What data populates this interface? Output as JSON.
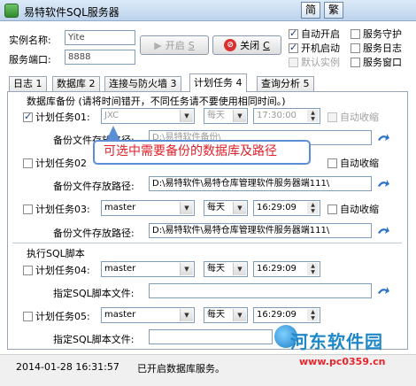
{
  "window": {
    "title": "易特软件SQL服务器",
    "btn_simplified": "简",
    "btn_traditional": "繁"
  },
  "top": {
    "instance_label": "实例名称:",
    "instance_value": "Yite",
    "port_label": "服务端口:",
    "port_value": "8888",
    "start_label": "开启",
    "start_key": "S",
    "close_label": "关闭",
    "close_key": "C",
    "checks": [
      {
        "label": "自动开启",
        "checked": true
      },
      {
        "label": "服务守护",
        "checked": false
      },
      {
        "label": "开机启动",
        "checked": true
      },
      {
        "label": "服务日志",
        "checked": false
      },
      {
        "label": "默认实例",
        "checked": false,
        "disabled": true
      },
      {
        "label": "服务窗口",
        "checked": false
      }
    ]
  },
  "tabs": [
    {
      "label": "日志 1"
    },
    {
      "label": "数据库 2"
    },
    {
      "label": "连接与防火墙 3"
    },
    {
      "label": "计划任务 4",
      "active": true
    },
    {
      "label": "查询分析 5"
    }
  ],
  "backup": {
    "section_title": "数据库备份 (请将时间错开，不同任务请不要使用相同时间。)",
    "path_label": "备份文件存放路径:",
    "tasks": [
      {
        "label": "计划任务01:",
        "checked": true,
        "db": "JXC",
        "freq": "每天",
        "time": "17:30:00",
        "auto_compress": "自动收缩",
        "path": "D:\\易特软件备份\\",
        "disabled": true
      },
      {
        "label": "计划任务02",
        "checked": false,
        "db": "",
        "freq": "",
        "time": "",
        "auto_compress": "自动收缩",
        "path": "D:\\易特软件\\易特仓库管理软件服务器端111\\"
      },
      {
        "label": "计划任务03:",
        "checked": false,
        "db": "master",
        "freq": "每天",
        "time": "16:29:09",
        "auto_compress": "自动收缩",
        "path": "D:\\易特软件\\易特仓库管理软件服务器端111\\"
      }
    ]
  },
  "sql": {
    "section_title": "执行SQL脚本",
    "file_label": "指定SQL脚本文件:",
    "tasks": [
      {
        "label": "计划任务04:",
        "db": "master",
        "freq": "每天",
        "time": "16:29:09",
        "file": ""
      },
      {
        "label": "计划任务05:",
        "db": "master",
        "freq": "每天",
        "time": "16:29:09",
        "file": ""
      }
    ]
  },
  "tooltip": "可选中需要备份的数据库及路径",
  "status": {
    "datetime": "2014-01-28 16:31:57",
    "message": "已开启数据库服务。"
  },
  "watermark": {
    "text": "河东软件园",
    "url": "www.pc0359.cn"
  }
}
